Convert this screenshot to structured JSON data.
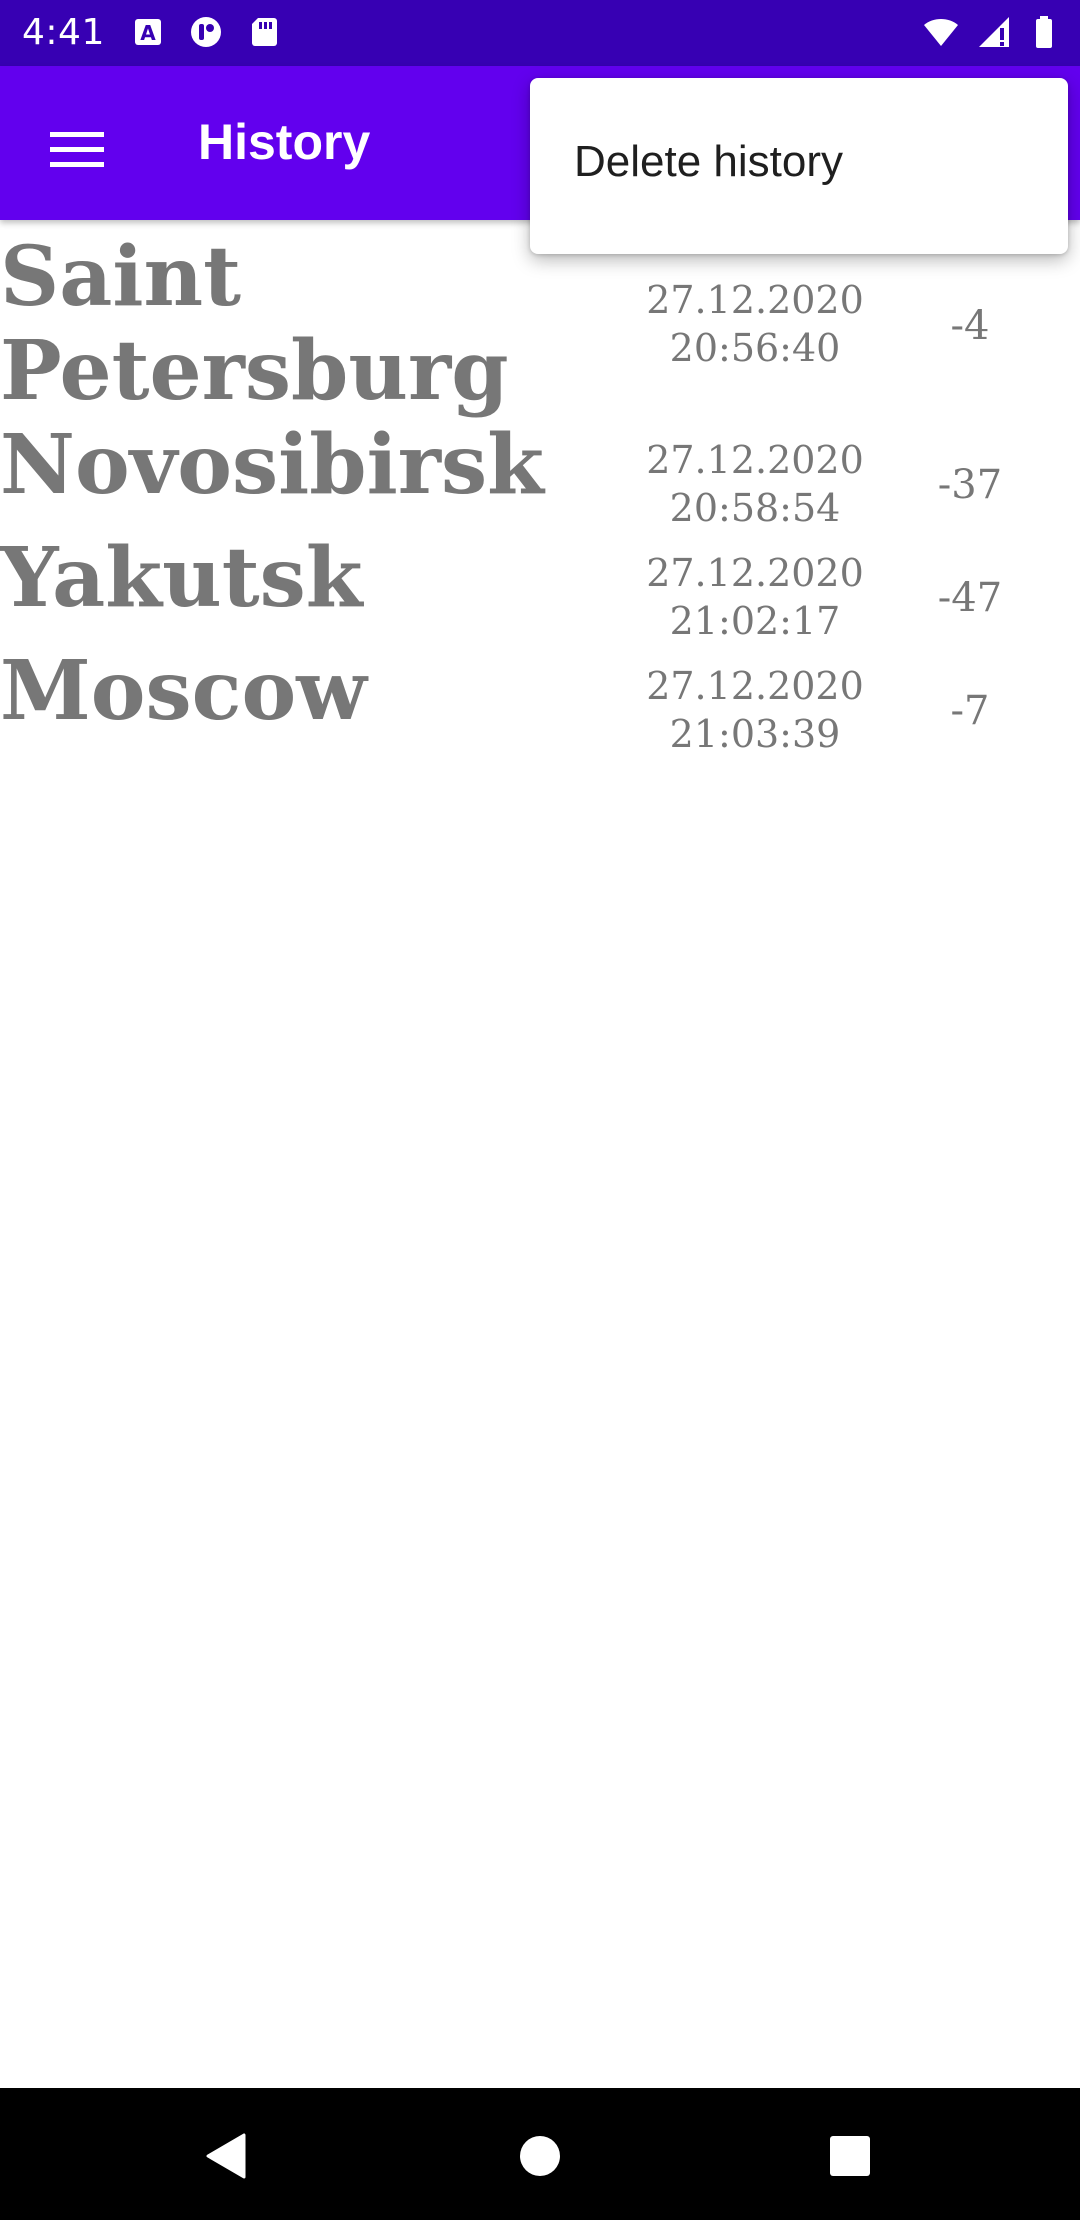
{
  "status_bar": {
    "time": "4:41",
    "left_icons": [
      "accessibility-a-icon",
      "notification-app-icon",
      "sd-card-icon"
    ],
    "right_icons": [
      "wifi-icon",
      "cell-signal-icon",
      "battery-icon"
    ]
  },
  "app_bar": {
    "menu_icon": "hamburger-menu-icon",
    "title": "History",
    "color": "#6200ee"
  },
  "popup_menu": {
    "items": [
      {
        "label": "Delete history"
      }
    ]
  },
  "history": {
    "rows": [
      {
        "city": "Saint\nPetersburg",
        "date": "27.12.2020",
        "time": "20:56:40",
        "temp": "-4"
      },
      {
        "city": "Novosibirsk",
        "date": "27.12.2020",
        "time": "20:58:54",
        "temp": "-37"
      },
      {
        "city": "Yakutsk",
        "date": "27.12.2020",
        "time": "21:02:17",
        "temp": "-47"
      },
      {
        "city": "Moscow",
        "date": "27.12.2020",
        "time": "21:03:39",
        "temp": "-7"
      }
    ]
  },
  "nav_bar": {
    "buttons": [
      "back-icon",
      "home-icon",
      "recents-icon"
    ]
  }
}
